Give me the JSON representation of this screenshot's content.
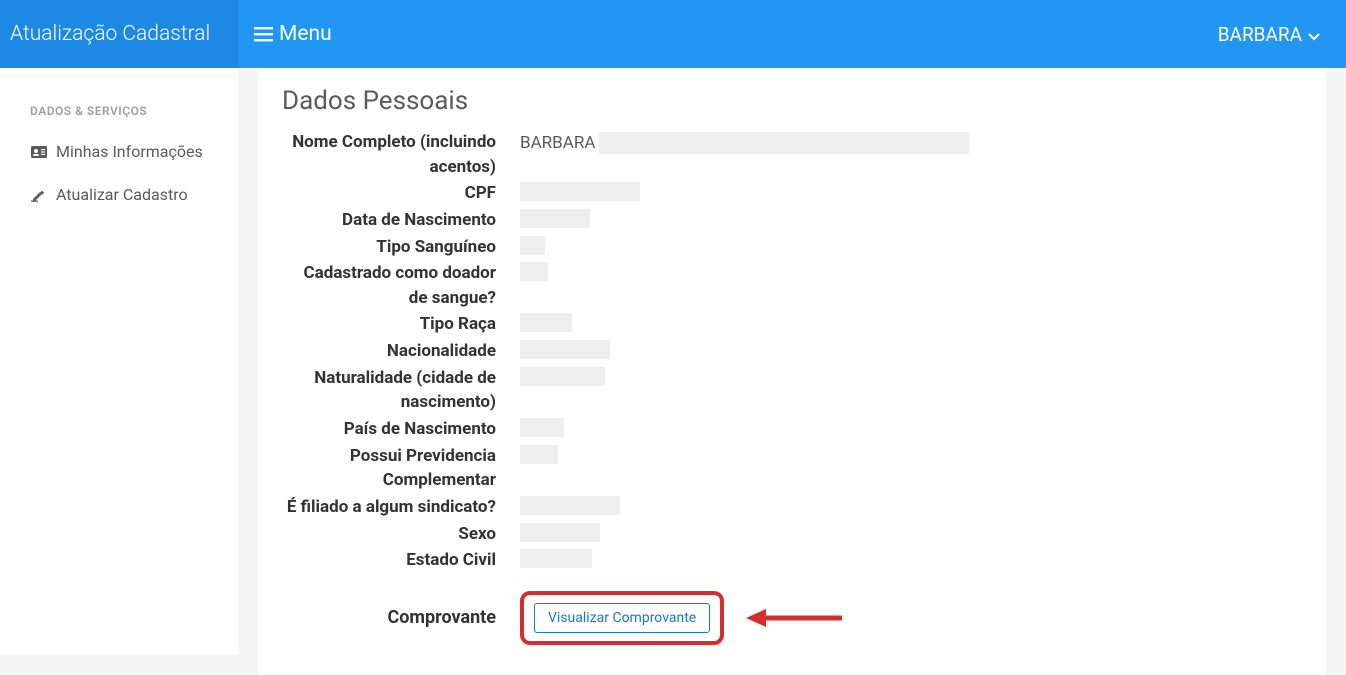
{
  "header": {
    "brand": "Atualização Cadastral",
    "menu_label": "Menu",
    "user_name": "BARBARA"
  },
  "sidebar": {
    "heading": "DADOS & SERVIÇOS",
    "items": [
      {
        "label": "Minhas Informações",
        "icon": "id-card-icon"
      },
      {
        "label": "Atualizar Cadastro",
        "icon": "edit-icon"
      }
    ]
  },
  "main": {
    "title": "Dados Pessoais",
    "fields": {
      "nome_label": "Nome Completo (incluindo acentos)",
      "nome_value": "BARBARA",
      "cpf_label": "CPF",
      "data_nascimento_label": "Data de Nascimento",
      "tipo_sanguineo_label": "Tipo Sanguíneo",
      "doador_label": "Cadastrado como doador de sangue?",
      "tipo_raca_label": "Tipo Raça",
      "nacionalidade_label": "Nacionalidade",
      "naturalidade_label": "Naturalidade (cidade de nascimento)",
      "pais_nascimento_label": "País de Nascimento",
      "previdencia_label": "Possui Previdencia Complementar",
      "sindicato_label": "É filiado a algum sindicato?",
      "sexo_label": "Sexo",
      "estado_civil_label": "Estado Civil",
      "comprovante_label": "Comprovante",
      "visualizar_button": "Visualizar Comprovante"
    }
  }
}
